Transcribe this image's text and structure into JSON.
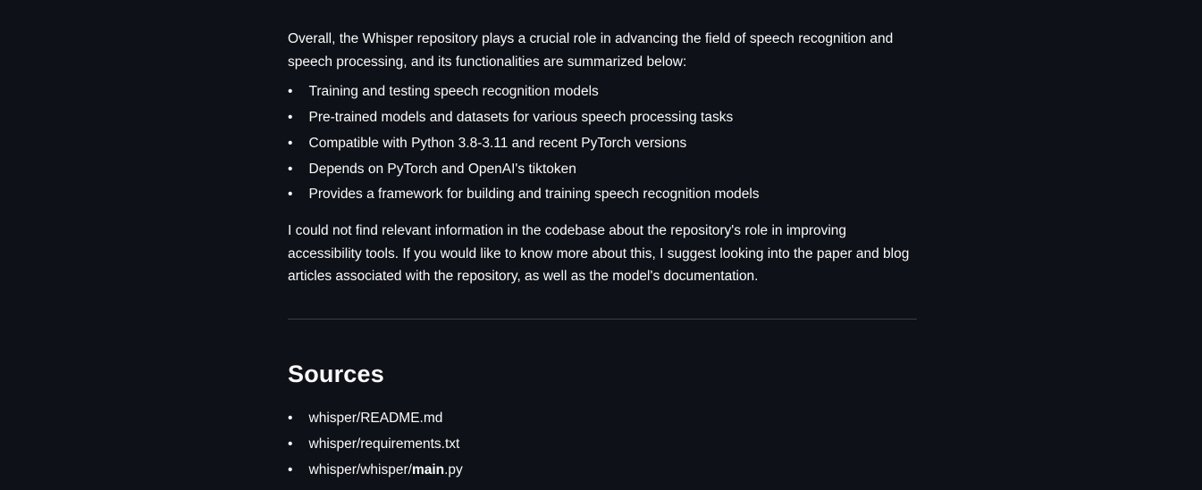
{
  "intro": "Overall, the Whisper repository plays a crucial role in advancing the field of speech recognition and speech processing, and its functionalities are summarized below:",
  "features": [
    "Training and testing speech recognition models",
    "Pre-trained models and datasets for various speech processing tasks",
    "Compatible with Python 3.8-3.11 and recent PyTorch versions",
    "Depends on PyTorch and OpenAI's tiktoken",
    "Provides a framework for building and training speech recognition models"
  ],
  "note": "I could not find relevant information in the codebase about the repository's role in improving accessibility tools. If you would like to know more about this, I suggest looking into the paper and blog articles associated with the repository, as well as the model's documentation.",
  "sources_heading": "Sources",
  "sources": [
    {
      "prefix": "whisper/README.md",
      "bold": "",
      "suffix": ""
    },
    {
      "prefix": "whisper/requirements.txt",
      "bold": "",
      "suffix": ""
    },
    {
      "prefix": "whisper/whisper/",
      "bold": "main",
      "suffix": ".py"
    }
  ],
  "bullet_glyph": "•"
}
